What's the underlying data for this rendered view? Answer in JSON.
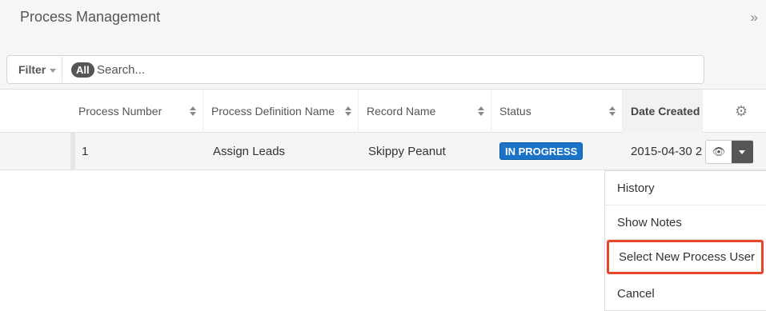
{
  "header": {
    "title": "Process Management",
    "collapse_icon": "»"
  },
  "filter": {
    "filter_label": "Filter",
    "all_label": "All",
    "search_placeholder": "Search..."
  },
  "table": {
    "columns": [
      {
        "label": "Process Number"
      },
      {
        "label": "Process Definition Name"
      },
      {
        "label": "Record Name"
      },
      {
        "label": "Status"
      },
      {
        "label": "Date Created"
      }
    ],
    "rows": [
      {
        "process_number": "1",
        "process_definition_name": "Assign Leads",
        "record_name": "Skippy Peanut",
        "status": "IN PROGRESS",
        "date_created": "2015-04-30 2"
      }
    ]
  },
  "menu": {
    "items": [
      {
        "label": "History"
      },
      {
        "label": "Show Notes"
      },
      {
        "label": "Select New Process User"
      },
      {
        "label": "Cancel"
      }
    ]
  },
  "colors": {
    "status_badge": "#1a73c7",
    "highlight_border": "#e8442a",
    "dark_button": "#555555"
  },
  "icons": {
    "settings": "gear-icon",
    "preview": "eye-icon",
    "actions": "caret-down-icon",
    "collapse": "double-chevron-right-icon"
  }
}
